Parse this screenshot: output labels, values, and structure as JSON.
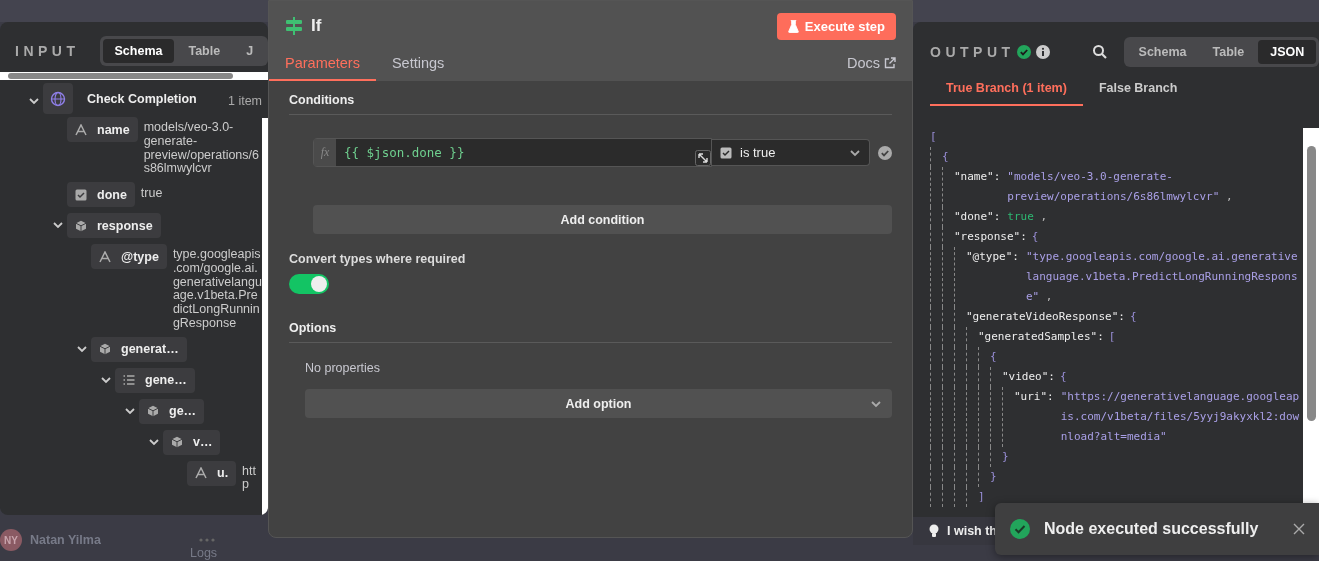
{
  "input_panel": {
    "title": "INPUT",
    "view_tabs": [
      {
        "label": "Schema",
        "selected": true
      },
      {
        "label": "Table",
        "selected": false
      },
      {
        "label": "J",
        "selected": false
      }
    ],
    "tree": [
      {
        "kind": "node",
        "key": "Check Completion",
        "count": "1 item",
        "expanded": true,
        "children": [
          {
            "kind": "string",
            "key": "name",
            "value": "models/veo-3.0-generate-preview/operations/6s86lmwylcvr"
          },
          {
            "kind": "boolean",
            "key": "done",
            "value": "true"
          },
          {
            "kind": "object",
            "key": "response",
            "expanded": true,
            "children": [
              {
                "kind": "string",
                "key": "@type",
                "value": "type.googleapis.com/google.ai.generativelanguage.v1beta.PredictLongRunningResponse"
              },
              {
                "kind": "object",
                "key": "generat…",
                "expanded": true,
                "children": [
                  {
                    "kind": "array",
                    "key": "gene…",
                    "expanded": true,
                    "children": [
                      {
                        "kind": "object",
                        "key": "ge…",
                        "expanded": true,
                        "children": [
                          {
                            "kind": "object",
                            "key": "v…",
                            "expanded": true,
                            "children": [
                              {
                                "kind": "string",
                                "key": "u.",
                                "value": "http"
                              }
                            ]
                          }
                        ]
                      }
                    ]
                  }
                ]
              }
            ]
          }
        ]
      }
    ]
  },
  "node_panel": {
    "title": "If",
    "execute_button": "Execute step",
    "tabs": [
      {
        "label": "Parameters",
        "selected": true
      },
      {
        "label": "Settings",
        "selected": false
      }
    ],
    "docs_link": "Docs",
    "conditions": {
      "label": "Conditions",
      "rows": [
        {
          "prefix": "fx",
          "expression": "{{ $json.done }}",
          "operator": "is true"
        }
      ],
      "add_button": "Add condition"
    },
    "convert_types": {
      "label": "Convert types where required",
      "on": true
    },
    "options": {
      "label": "Options",
      "empty_text": "No properties",
      "add_button": "Add option"
    }
  },
  "output_panel": {
    "title": "OUTPUT",
    "view_tabs": [
      {
        "label": "Schema",
        "selected": false
      },
      {
        "label": "Table",
        "selected": false
      },
      {
        "label": "JSON",
        "selected": true
      }
    ],
    "branch_tabs": [
      {
        "label": "True Branch (1 item)",
        "selected": true
      },
      {
        "label": "False Branch",
        "selected": false
      }
    ],
    "json_view": {
      "open": "[",
      "children": [
        {
          "open": "{",
          "children": [
            {
              "key": "\"name\":",
              "kind": "string",
              "value": "\"models/veo-3.0-generate-preview/operations/6s86lmwylcvr\"",
              "punct": ","
            },
            {
              "key": "\"done\":",
              "kind": "boolean",
              "value": "true",
              "punct": ","
            },
            {
              "key": "\"response\":",
              "open": "{",
              "children": [
                {
                  "key": "\"@type\":",
                  "kind": "string",
                  "value": "\"type.googleapis.com/google.ai.generativelanguage.v1beta.PredictLongRunningResponse\"",
                  "punct": ","
                },
                {
                  "key": "\"generateVideoResponse\":",
                  "open": "{",
                  "children": [
                    {
                      "key": "\"generatedSamples\":",
                      "open": "[",
                      "children": [
                        {
                          "open": "{",
                          "children": [
                            {
                              "key": "\"video\":",
                              "open": "{",
                              "children": [
                                {
                                  "key": "\"uri\":",
                                  "kind": "string",
                                  "value": "\"https://generativelanguage.googleapis.com/v1beta/files/5yyj9akyxkl2:download?alt=media\""
                                }
                              ],
                              "close": "}"
                            }
                          ],
                          "close": "}"
                        }
                      ],
                      "close": "]"
                    }
                  ]
                }
              ]
            }
          ]
        }
      ]
    }
  },
  "feedback": {
    "text": "I wish th"
  },
  "toast": {
    "message": "Node executed successfully"
  },
  "user": {
    "initials": "NY",
    "name": "Natan Yilma"
  },
  "logs_label": "Logs"
}
